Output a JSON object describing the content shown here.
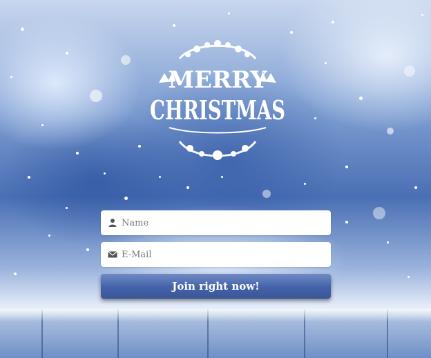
{
  "logo": {
    "line1": "MERRY",
    "line2": "CHRISTMAS",
    "icon": "merry-christmas-wreath-logo"
  },
  "form": {
    "name_placeholder": "Name",
    "name_value": "",
    "name_icon": "user-icon",
    "email_placeholder": "E-Mail",
    "email_value": "",
    "email_icon": "envelope-icon",
    "submit_label": "Join right now!"
  },
  "colors": {
    "button": "#4462a8",
    "background_blue": "#4a6fb4",
    "field_background": "#ffffff"
  }
}
